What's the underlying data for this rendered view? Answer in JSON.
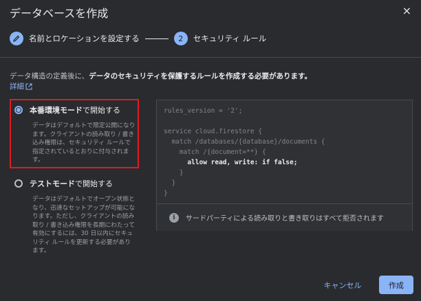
{
  "dialog": {
    "title": "データベースを作成",
    "close_icon": "×"
  },
  "stepper": {
    "step1_icon": "pencil-icon",
    "step1_label": "名前とロケーションを設定する",
    "step2_number": "2",
    "step2_label": "セキュリティ ルール"
  },
  "description": {
    "prefix": "データ構造の定義後に、",
    "bold": "データのセキュリティを保護するルールを作成する必要があります。",
    "link_label": "詳細"
  },
  "options": {
    "production": {
      "bold": "本番環境モード",
      "rest": "で開始する",
      "checked": true,
      "desc": "データはデフォルトで限定公開になります。クライアントの読み取り / 書き込み権限は、セキュリティ ルールで指定されているとおりに付与されます。"
    },
    "test": {
      "bold": "テストモード",
      "rest": "で開始する",
      "checked": false,
      "desc": "データはデフォルトでオープン状態となり、迅速なセットアップが可能になります。ただし、クライアントの読み取り / 書き込み権限を長期にわたって有効にするには、30 日以内にセキュリティ ルールを更新する必要があります。"
    }
  },
  "code": {
    "line1": "rules_version = '2';",
    "line2": "service cloud.firestore {",
    "line3": "  match /databases/{database}/documents {",
    "line4": "    match /{document=**} {",
    "line5": "      allow read, write: if false;",
    "line6": "    }",
    "line7": "  }",
    "line8": "}"
  },
  "info": {
    "text": "サードパーティによる読み取りと書き取りはすべて拒否されます"
  },
  "footer": {
    "cancel_label": "キャンセル",
    "create_label": "作成"
  },
  "colors": {
    "accent": "#8ab4f8",
    "highlight": "#e01b22",
    "background": "#2a2b2e"
  }
}
